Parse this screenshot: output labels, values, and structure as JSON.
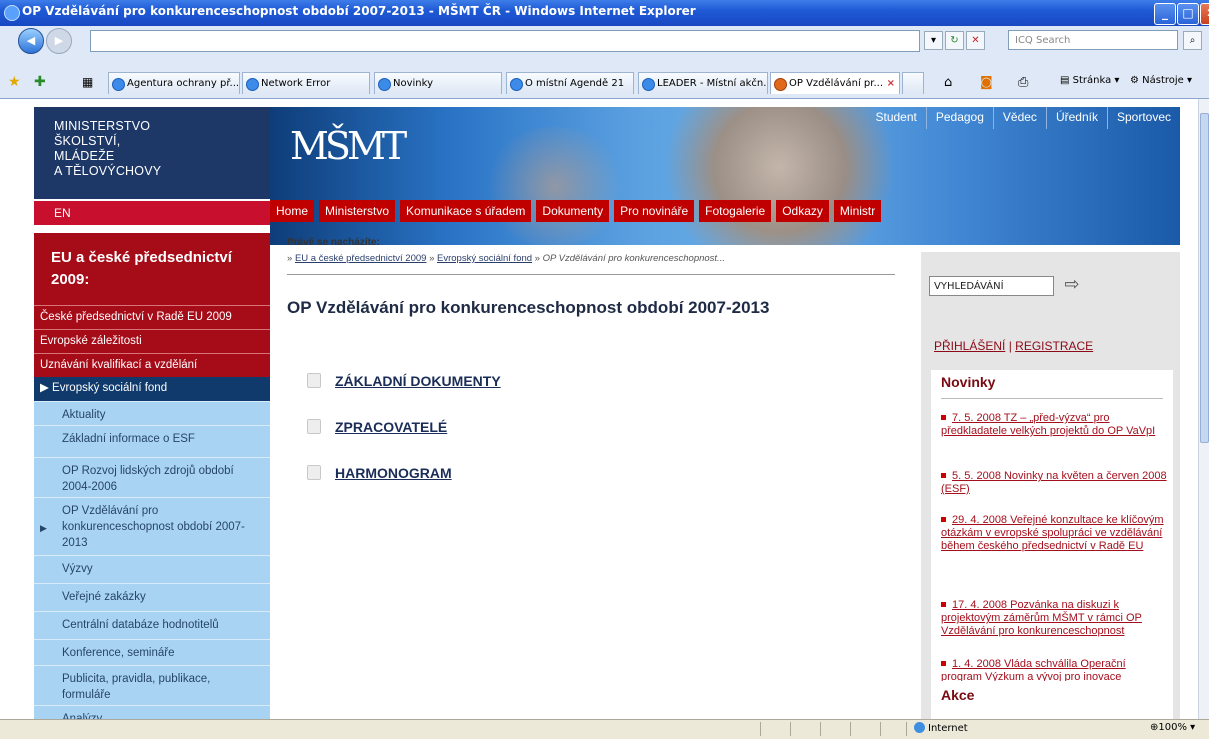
{
  "window": {
    "title": "OP Vzdělávání pro konkurenceschopnost období 2007-2013 - MŠMT ČR - Windows Internet Explorer",
    "search_placeholder": "ICQ Search"
  },
  "tabs": [
    {
      "label": "Agentura ochrany př..."
    },
    {
      "label": "Network Error"
    },
    {
      "label": "Novinky"
    },
    {
      "label": "O místní Agendě 21"
    },
    {
      "label": "LEADER - Místní akčn..."
    },
    {
      "label": "OP Vzdělávání pr...",
      "active": true
    }
  ],
  "commands": {
    "page": "Stránka",
    "tools": "Nástroje"
  },
  "site": {
    "ministry_lines": [
      "MINISTERSTVO",
      "ŠKOLSTVÍ,",
      "MLÁDEŽE",
      "A TĚLOVÝCHOVY"
    ],
    "logo": "MŠMT",
    "en_label": "EN",
    "top_nav": [
      "Student",
      "Pedagog",
      "Vědec",
      "Úředník",
      "Sportovec"
    ],
    "main_nav": [
      "Home",
      "Ministerstvo",
      "Komunikace s úřadem",
      "Dokumenty",
      "Pro novináře",
      "Fotogalerie",
      "Odkazy",
      "Ministr"
    ]
  },
  "sidebar": {
    "title": "EU a české předsednictví 2009:",
    "red_items": [
      "České předsednictví v Radě EU 2009",
      "Evropské záležitosti",
      "Uznávání kvalifikací a vzdělání"
    ],
    "active_section": "Evropský sociální fond",
    "sub_items": [
      "Aktuality",
      "Základní informace o ESF",
      "OP Rozvoj lidských zdrojů období 2004-2006",
      "OP Vzdělávání pro konkurenceschopnost období 2007-2013",
      "Výzvy",
      "Veřejné zakázky",
      "Centrální databáze hodnotitelů",
      "Konference, semináře",
      "Publicita, pravidla, publikace, formuláře",
      "Analýzy"
    ]
  },
  "breadcrumb": {
    "label": "Právě se nacházíte:",
    "links": [
      "EU a české předsednictví 2009",
      "Evropský sociální fond"
    ],
    "current": "OP Vzdělávání pro konkurenceschopnost..."
  },
  "main": {
    "heading": "OP Vzdělávání pro konkurenceschopnost období 2007-2013",
    "documents": [
      "ZÁKLADNÍ DOKUMENTY",
      "ZPRACOVATELÉ",
      "HARMONOGRAM"
    ]
  },
  "right": {
    "search_value": "VYHLEDÁVÁNÍ",
    "login": "PŘIHLÁŠENÍ",
    "register": "REGISTRACE",
    "news_title": "Novinky",
    "news": [
      "7. 5. 2008 TZ – „před-výzva“ pro předkladatele velkých projektů do OP VaVpI",
      "5. 5. 2008 Novinky na květen a červen 2008 (ESF)",
      "29. 4. 2008 Veřejné konzultace ke klíčovým otázkám v evropské spolupráci ve vzdělávání během českého předsednictví v Radě EU",
      "17. 4. 2008 Pozvánka na diskuzi k projektovým záměrům MŠMT v rámci OP Vzdělávání pro konkurenceschopnost",
      "1. 4. 2008 Vláda schválila Operační program Výzkum a vývoj pro inovace"
    ],
    "events_title": "Akce"
  },
  "status": {
    "zone": "Internet",
    "zoom": "100%"
  }
}
